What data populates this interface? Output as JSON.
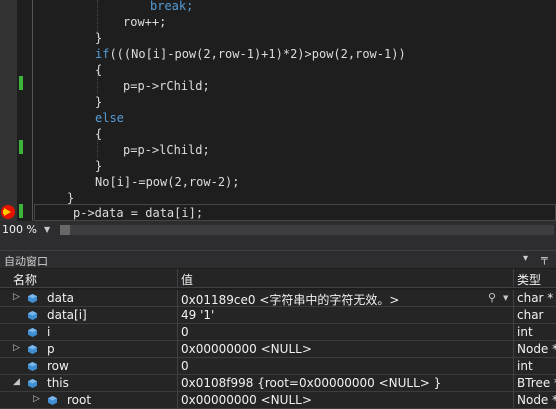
{
  "editor": {
    "lines": [
      {
        "segs": [
          {
            "t": "break;",
            "k": "kw"
          }
        ]
      },
      {
        "segs": [
          {
            "t": "row++;",
            "k": ""
          }
        ]
      },
      {
        "segs": [
          {
            "t": "}",
            "k": ""
          }
        ]
      },
      {
        "segs": [
          {
            "t": "if",
            "k": "kw"
          },
          {
            "t": "(((No[i]-pow(2,row-1)+1)*2)>pow(2,row-1))",
            "k": ""
          }
        ]
      },
      {
        "segs": [
          {
            "t": "{",
            "k": ""
          }
        ]
      },
      {
        "segs": [
          {
            "t": "p=p->rChild;",
            "k": ""
          }
        ]
      },
      {
        "segs": [
          {
            "t": "}",
            "k": ""
          }
        ]
      },
      {
        "segs": [
          {
            "t": "else",
            "k": "kw"
          }
        ]
      },
      {
        "segs": [
          {
            "t": "{",
            "k": ""
          }
        ]
      },
      {
        "segs": [
          {
            "t": "p=p->lChild;",
            "k": ""
          }
        ]
      },
      {
        "segs": [
          {
            "t": "}",
            "k": ""
          }
        ]
      },
      {
        "segs": [
          {
            "t": "No[i]-=pow(2,row-2);",
            "k": ""
          }
        ]
      },
      {
        "segs": [
          {
            "t": "}",
            "k": ""
          }
        ]
      },
      {
        "segs": [
          {
            "t": "p->data = data[i];",
            "k": ""
          }
        ]
      }
    ]
  },
  "zoom": {
    "value": "100 %",
    "scroll_fraction": 0.02
  },
  "autos": {
    "title": "自动窗口",
    "chevron": "▾",
    "pin": "╤",
    "columns": {
      "name": "名称",
      "value": "值",
      "type": "类型"
    },
    "rows": [
      {
        "expander": "▷",
        "name": "data",
        "value": "0x01189ce0 <字符串中的字符无效。>",
        "type": "char *",
        "search": true
      },
      {
        "expander": "",
        "name": "data[i]",
        "value": "49 '1'",
        "type": "char"
      },
      {
        "expander": "",
        "name": "i",
        "value": "0",
        "type": "int"
      },
      {
        "expander": "▷",
        "name": "p",
        "value": "0x00000000 <NULL>",
        "type": "Node *"
      },
      {
        "expander": "",
        "name": "row",
        "value": "0",
        "type": "int"
      },
      {
        "expander": "◢",
        "name": "this",
        "value": "0x0108f998 {root=0x00000000 <NULL> }",
        "type": "BTree *"
      },
      {
        "expander": "▷",
        "name": "root",
        "value": "0x00000000 <NULL>",
        "type": "Node *",
        "child": true
      }
    ]
  },
  "colors": {
    "keyword": "#569cd6",
    "text": "#dcdcdc",
    "change_bar": "#3cb43c",
    "breakpoint": "#e51400"
  }
}
